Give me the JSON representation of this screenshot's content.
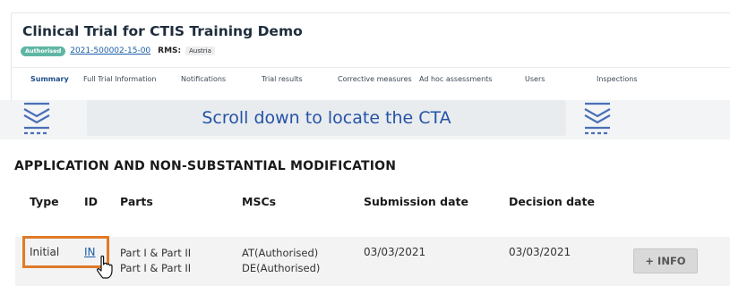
{
  "header": {
    "title": "Clinical Trial for CTIS Training Demo",
    "status": "Authorised",
    "trial_number": "2021-500002-15-00",
    "rms_label": "RMS:",
    "rms_value": "Austria"
  },
  "tabs": [
    {
      "label": "Summary",
      "active": true
    },
    {
      "label": "Full Trial Information"
    },
    {
      "label": "Notifications"
    },
    {
      "label": "Trial results"
    },
    {
      "label": "Corrective measures"
    },
    {
      "label": "Ad hoc assessments"
    },
    {
      "label": "Users"
    },
    {
      "label": "Inspections"
    }
  ],
  "banner": {
    "text": "Scroll down to locate the CTA"
  },
  "section": {
    "title": "APPLICATION AND NON-SUBSTANTIAL MODIFICATION",
    "columns": [
      "Type",
      "ID",
      "Parts",
      "MSCs",
      "Submission date",
      "Decision date"
    ],
    "row": {
      "type": "Initial",
      "id": "IN",
      "parts": [
        "Part I & Part II",
        "Part I & Part II"
      ],
      "mscs": [
        "AT(Authorised)",
        "DE(Authorised)"
      ],
      "submission_date": "03/03/2021",
      "decision_date": "03/03/2021",
      "info_button": "+ INFO"
    }
  },
  "colors": {
    "accent": "#2a72c6",
    "badge": "#5fb6a4",
    "highlight": "#e07a28",
    "banner_text": "#2453a6"
  }
}
